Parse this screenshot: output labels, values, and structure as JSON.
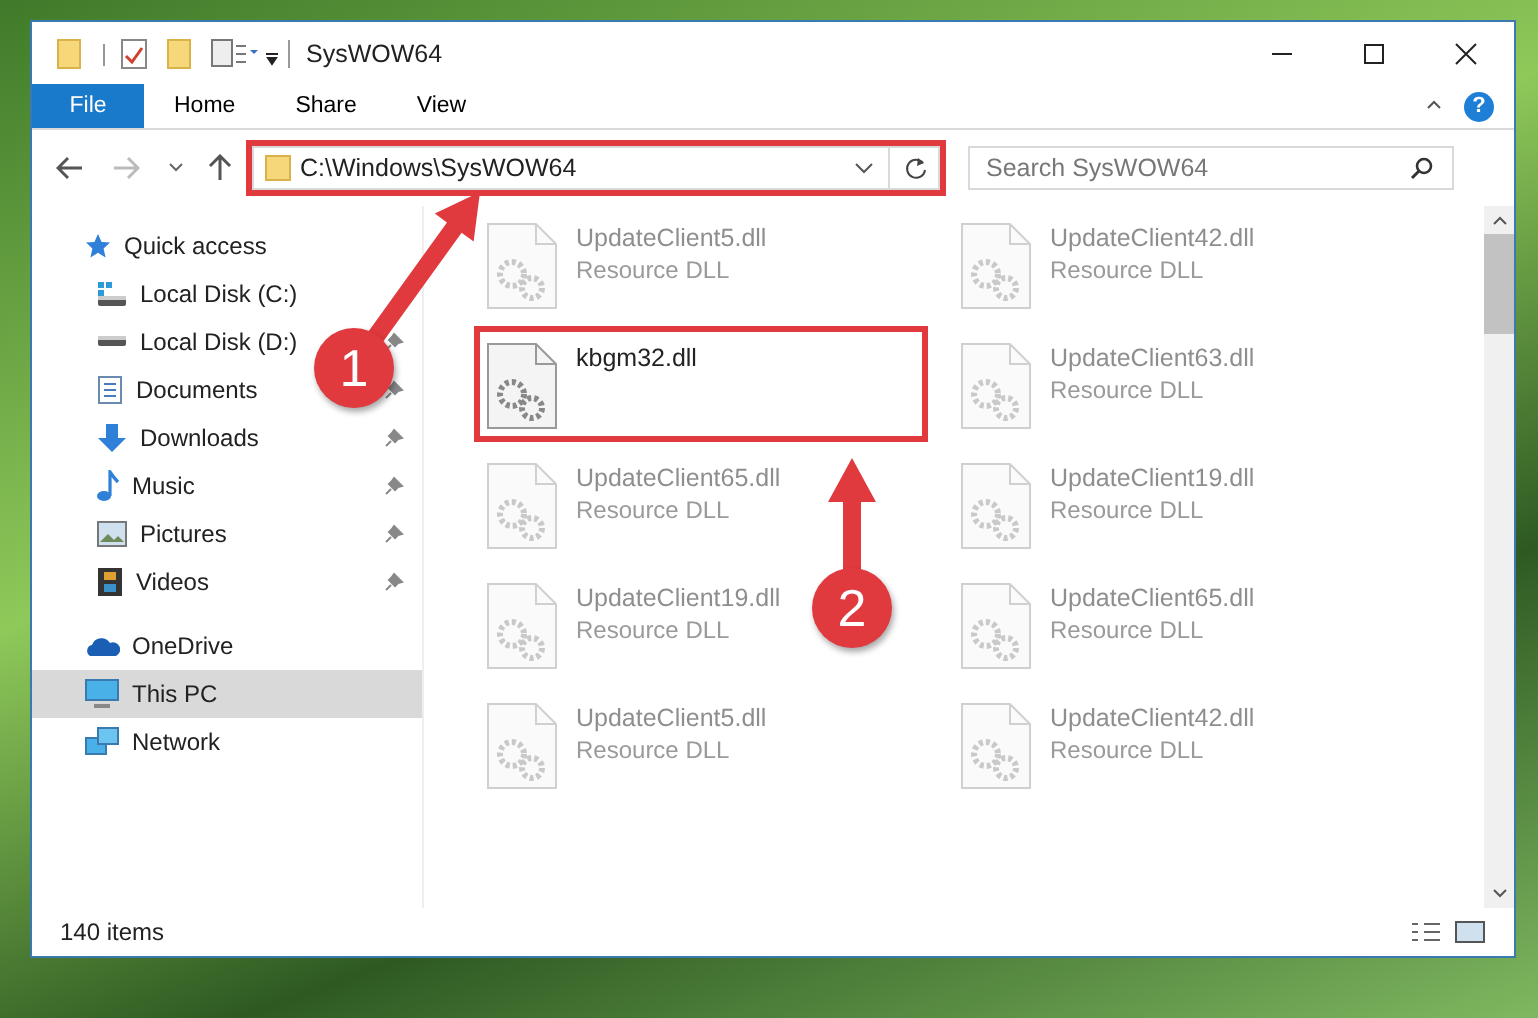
{
  "window": {
    "title": "SysWOW64"
  },
  "ribbon": {
    "file_button": "File",
    "tabs": [
      "Home",
      "Share",
      "View"
    ],
    "help": "?"
  },
  "address": {
    "path": "C:\\Windows\\SysWOW64",
    "highlighted": true
  },
  "search": {
    "placeholder": "Search SysWOW64"
  },
  "sidebar": {
    "items": [
      {
        "label": "Quick access",
        "kind": "star",
        "selected": false,
        "children": [
          {
            "label": "Local Disk (C:)",
            "kind": "drive-c",
            "selected": false
          },
          {
            "label": "Local Disk (D:)",
            "kind": "drive",
            "pinned": true,
            "selected": false
          },
          {
            "label": "Documents",
            "kind": "documents",
            "pinned": true,
            "selected": false
          },
          {
            "label": "Downloads",
            "kind": "downloads",
            "pinned": true,
            "selected": false
          },
          {
            "label": "Music",
            "kind": "music",
            "pinned": true,
            "selected": false
          },
          {
            "label": "Pictures",
            "kind": "pictures",
            "pinned": true,
            "selected": false
          },
          {
            "label": "Videos",
            "kind": "videos",
            "pinned": true,
            "selected": false
          }
        ]
      },
      {
        "label": "OneDrive",
        "kind": "cloud",
        "selected": false
      },
      {
        "label": "This PC",
        "kind": "pc",
        "selected": true
      },
      {
        "label": "Network",
        "kind": "network",
        "selected": false
      }
    ]
  },
  "files": [
    {
      "name": "UpdateClient5.dll",
      "type": "Resource DLL",
      "highlighted": false
    },
    {
      "name": "UpdateClient42.dll",
      "type": "Resource DLL",
      "highlighted": false
    },
    {
      "name": "kbgm32.dll",
      "highlighted": true
    },
    {
      "name": "UpdateClient63.dll",
      "type": "Resource DLL",
      "highlighted": false
    },
    {
      "name": "UpdateClient65.dll",
      "type": "Resource DLL",
      "highlighted": false
    },
    {
      "name": "UpdateClient19.dll",
      "type": "Resource DLL",
      "highlighted": false
    },
    {
      "name": "UpdateClient19.dll",
      "type": "Resource DLL",
      "highlighted": false
    },
    {
      "name": "UpdateClient65.dll",
      "type": "Resource DLL",
      "highlighted": false
    },
    {
      "name": "UpdateClient5.dll",
      "type": "Resource DLL",
      "highlighted": false
    },
    {
      "name": "UpdateClient42.dll",
      "type": "Resource DLL",
      "highlighted": false
    }
  ],
  "annotations": [
    {
      "number": "1"
    },
    {
      "number": "2"
    }
  ],
  "status_bar": {
    "count": "140 items"
  }
}
